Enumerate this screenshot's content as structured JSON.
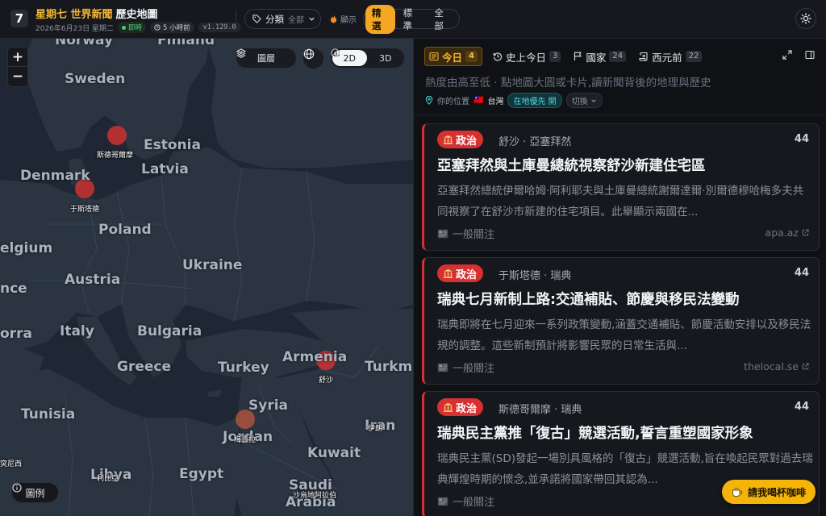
{
  "header": {
    "logo_char": "7",
    "title_highlight": "星期七 世界新聞",
    "title_rest": "歷史地圖",
    "date": "2026年6月23日 星期二",
    "live_label": "即時",
    "updated_label": "5 小時前",
    "version": "v1.129.0",
    "category_label": "分類",
    "category_value": "全部",
    "display_label": "顯示",
    "modes": [
      "精選",
      "標準",
      "全部"
    ],
    "active_mode": "精選"
  },
  "map": {
    "layers_label": "圖層",
    "dim_2d": "2D",
    "dim_3d": "3D",
    "legend_label": "圖例",
    "country_labels": [
      "Norway",
      "Finland",
      "Sweden",
      "Estonia",
      "Latvia",
      "Denmark",
      "Poland",
      "elgium",
      "Ukraine",
      "Austria",
      "nce",
      "Italy",
      "Bulgaria",
      "orra",
      "Greece",
      "Turkey",
      "Armenia",
      "Turkm",
      "Syria",
      "Iran",
      "Tunisia",
      "Jordan",
      "Kuwait",
      "Libya",
      "Egypt",
      "Saudi",
      "Arabia"
    ],
    "city_labels": [
      "斯德哥爾摩",
      "于斯塔德",
      "舒沙",
      "梅圖拉",
      "沙烏地阿拉伯",
      "利比亞",
      "伊朗",
      "突尼西"
    ]
  },
  "panel": {
    "tabs": [
      {
        "label": "今日",
        "count": "4",
        "active": true
      },
      {
        "label": "史上今日",
        "count": "3",
        "active": false
      },
      {
        "label": "國家",
        "count": "24",
        "active": false
      },
      {
        "label": "西元前",
        "count": "22",
        "active": false
      }
    ],
    "description": "熱度由高至低 · 點地圖大圓或卡片,讀新聞背後的地理與歷史",
    "location_label": "你的位置",
    "location_flag": "🇹🇼",
    "location_value": "台灣",
    "local_first_label": "在地優先 開",
    "switch_label": "切換"
  },
  "cards": [
    {
      "category": "政治",
      "place": "舒沙 · 亞塞拜然",
      "score": "44",
      "title": "亞塞拜然與土庫曼總統視察舒沙新建住宅區",
      "body": "亞塞拜然總統伊爾哈姆·阿利耶夫與土庫曼總統謝爾達爾·別爾德穆哈梅多夫共同視察了在舒沙市新建的住宅項目。此舉顯示兩國在...",
      "tag": "一般關注",
      "source": "apa.az"
    },
    {
      "category": "政治",
      "place": "于斯塔德 · 瑞典",
      "score": "44",
      "title": "瑞典七月新制上路:交通補貼、節慶與移民法變動",
      "body": "瑞典即將在七月迎來一系列政策變動,涵蓋交通補貼、節慶活動安排以及移民法規的調整。這些新制預計將影響民眾的日常生活與...",
      "tag": "一般關注",
      "source": "thelocal.se"
    },
    {
      "category": "政治",
      "place": "斯德哥爾摩 · 瑞典",
      "score": "44",
      "title": "瑞典民主黨推「復古」競選活動,誓言重塑國家形象",
      "body": "瑞典民主黨(SD)發起一場別具風格的「復古」競選活動,旨在喚起民眾對過去瑞典輝煌時期的懷念,並承諾將國家帶回其認為...",
      "tag": "一般關注",
      "source": ""
    }
  ],
  "coffee_label": "請我喝杯咖啡",
  "colors": {
    "accent": "#f5a623",
    "politics": "#d73030",
    "teal": "#4fd6dd",
    "live": "#3fd173"
  }
}
